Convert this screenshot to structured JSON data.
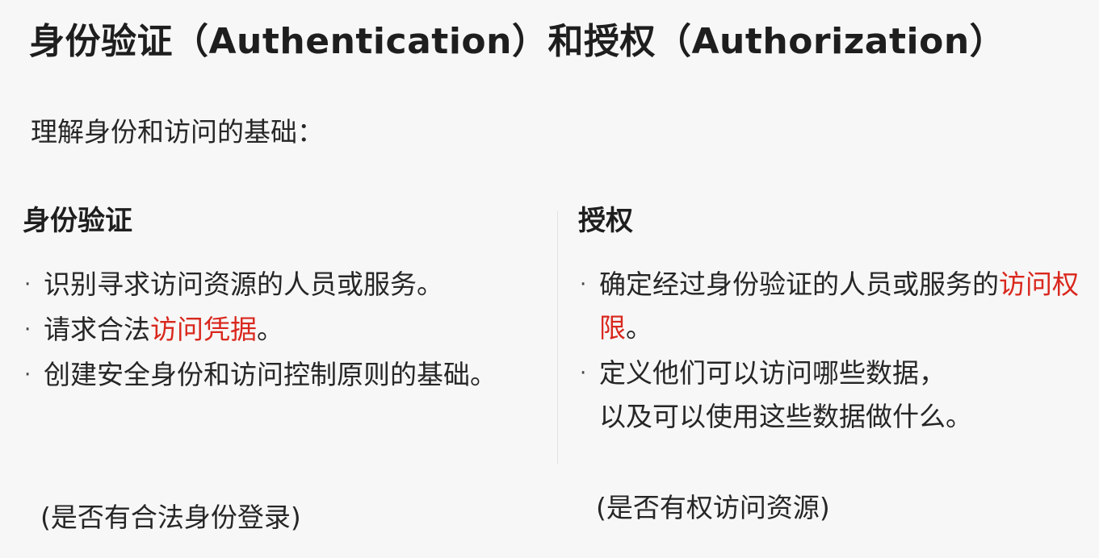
{
  "title": "身份验证（Authentication）和授权（Authorization）",
  "intro": "理解身份和访问的基础：",
  "bullet_mark": "·",
  "accent_color": "#d9271d",
  "authentication": {
    "heading": "身份验证",
    "bullets": [
      {
        "pre": "识别寻求访问资源的人员或服务。",
        "hl": "",
        "post": ""
      },
      {
        "pre": "请求合法",
        "hl": "访问凭据",
        "post": "。"
      },
      {
        "pre": "创建安全身份和访问控制原则的基础。",
        "hl": "",
        "post": ""
      }
    ],
    "note": "(是否有合法身份登录)"
  },
  "authorization": {
    "heading": "授权",
    "bullets": [
      {
        "pre": "确定经过身份验证的人员或服务的",
        "hl": "访问权限",
        "post": "。"
      },
      {
        "pre": "定义他们可以访问哪些数据，",
        "hl": "",
        "post": "",
        "line2": "以及可以使用这些数据做什么。"
      }
    ],
    "note": "(是否有权访问资源)"
  }
}
